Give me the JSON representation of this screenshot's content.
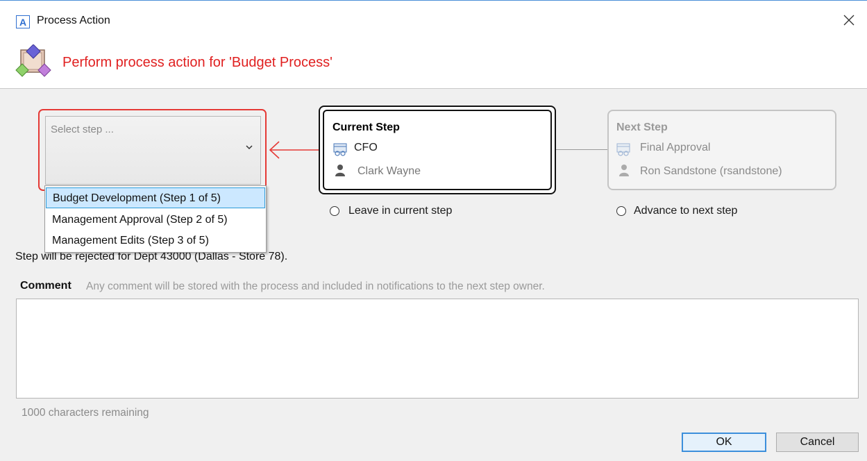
{
  "window": {
    "app_logo_letter": "A",
    "title": "Process Action",
    "close_icon": "close-icon"
  },
  "header": {
    "icon": "process-icon",
    "text": "Perform process action for 'Budget Process'"
  },
  "step_select": {
    "placeholder": "Select step ...",
    "options": [
      "Budget Development (Step 1 of 5)",
      "Management Approval (Step 2 of 5)",
      "Management Edits (Step 3 of 5)"
    ],
    "highlighted_index": 0
  },
  "current_step": {
    "title": "Current Step",
    "role": "CFO",
    "person": "Clark Wayne",
    "radio_label": "Leave in current step"
  },
  "next_step": {
    "title": "Next Step",
    "role": "Final Approval",
    "person": "Ron Sandstone (rsandstone)",
    "radio_label": "Advance to next step"
  },
  "message": "Step will be rejected for Dept 43000 (Dallas - Store 78).",
  "comment": {
    "label": "Comment",
    "hint": "Any comment will be stored with the process and included in notifications to the next step owner.",
    "value": "",
    "remaining": "1000 characters remaining"
  },
  "buttons": {
    "ok": "OK",
    "cancel": "Cancel"
  },
  "colors": {
    "accent_red": "#e53935",
    "selection_blue": "#cce8ff",
    "ok_border": "#3c8fdb"
  }
}
